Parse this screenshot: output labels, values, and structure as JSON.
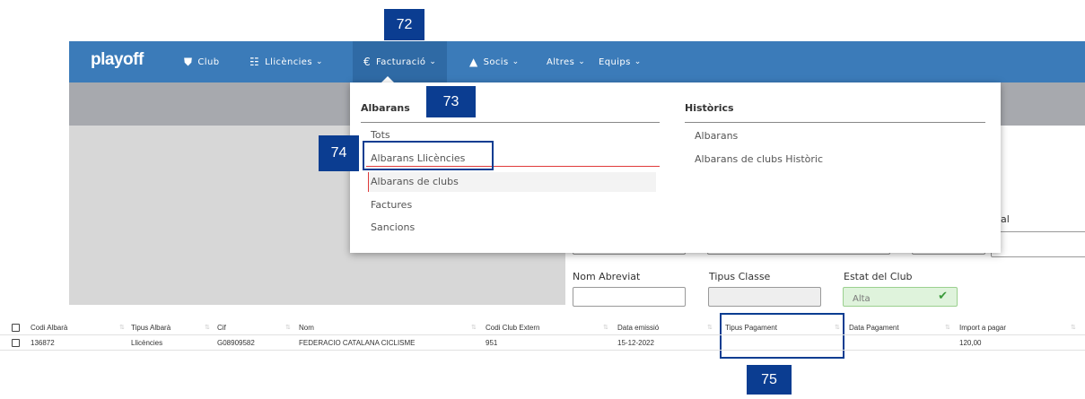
{
  "nav": {
    "logo": "playoff",
    "items": [
      {
        "label": "Club",
        "icon": "shield-icon"
      },
      {
        "label": "Llicències",
        "icon": "id-card-icon"
      },
      {
        "label": "Facturació",
        "icon": "euro-icon"
      },
      {
        "label": "Socis",
        "icon": "user-icon"
      },
      {
        "label": "Altres"
      },
      {
        "label": "Equips"
      }
    ]
  },
  "dropdown": {
    "albarans_title": "Albarans",
    "albarans_items": [
      "Tots",
      "Albarans Llicències",
      "Albarans de clubs",
      "Factures",
      "Sancions"
    ],
    "historics_title": "Històrics",
    "historics_items": [
      "Albarans",
      "Albarans de clubs Històric"
    ]
  },
  "form": {
    "nom_abreviat": "Nom Abreviat",
    "tipus_classe": "Tipus Classe",
    "estat_club": "Estat del Club",
    "estat_value": "Alta",
    "partial_label": "al"
  },
  "markers": {
    "m72": "72",
    "m73": "73",
    "m74": "74",
    "m75": "75"
  },
  "table": {
    "headers": [
      "Codi Albarà",
      "Tipus Albarà",
      "Cif",
      "Nom",
      "Codi Club Extern",
      "Data emissió",
      "Tipus Pagament",
      "Data Pagament",
      "Import a pagar"
    ],
    "rows": [
      [
        "136872",
        "Llicències",
        "G08909582",
        "FEDERACIO CATALANA CICLISME",
        "951",
        "15-12-2022",
        "",
        "",
        "120,00"
      ]
    ]
  },
  "colors": {
    "nav": "#3b7bb9",
    "marker": "#0b3d91",
    "accent_red": "#e03a3a"
  }
}
